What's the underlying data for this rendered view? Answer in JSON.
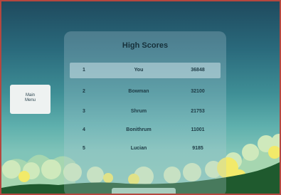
{
  "panel": {
    "title": "High Scores"
  },
  "scores": [
    {
      "rank": "1",
      "name": "You",
      "score": "36848"
    },
    {
      "rank": "2",
      "name": "Bowman",
      "score": "32100"
    },
    {
      "rank": "3",
      "name": "Shrum",
      "score": "21753"
    },
    {
      "rank": "4",
      "name": "Bonithrum",
      "score": "11001"
    },
    {
      "rank": "5",
      "name": "Lucian",
      "score": "9185"
    }
  ],
  "back_button": {
    "line1": "Main",
    "line2": "Menu"
  },
  "colors": {
    "border": "#b5473f",
    "sky_top": "#1f4a5e",
    "sky_bottom": "#8ccab6",
    "foliage_light": "#c6e8b5",
    "foliage_yellow": "#f2ea6a",
    "ground": "#1f5a2e"
  }
}
